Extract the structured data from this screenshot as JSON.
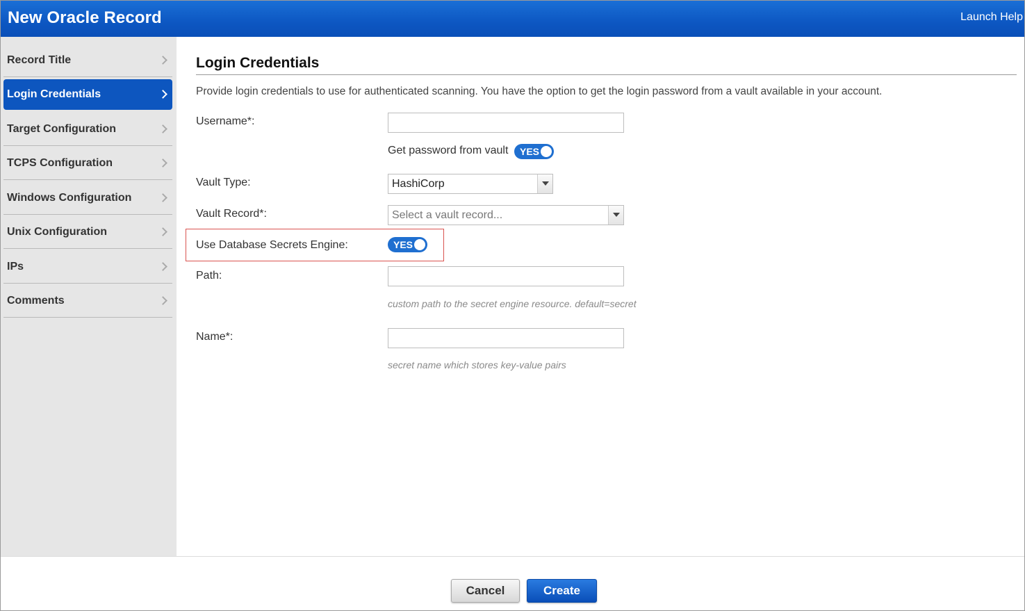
{
  "window": {
    "title": "New Oracle Record",
    "help_link": "Launch Help"
  },
  "sidebar": {
    "items": [
      {
        "label": "Record Title",
        "active": false
      },
      {
        "label": "Login Credentials",
        "active": true
      },
      {
        "label": "Target Configuration",
        "active": false
      },
      {
        "label": "TCPS Configuration",
        "active": false
      },
      {
        "label": "Windows Configuration",
        "active": false
      },
      {
        "label": "Unix Configuration",
        "active": false
      },
      {
        "label": "IPs",
        "active": false
      },
      {
        "label": "Comments",
        "active": false
      }
    ]
  },
  "form": {
    "section_title": "Login Credentials",
    "description": "Provide login credentials to use for authenticated scanning. You have the option to get the login password from a vault available in your account.",
    "username": {
      "label": "Username*:",
      "value": ""
    },
    "vault_toggle": {
      "label": "Get password from vault",
      "state": "YES"
    },
    "vault_type": {
      "label": "Vault Type:",
      "value": "HashiCorp"
    },
    "vault_record": {
      "label": "Vault Record*:",
      "placeholder": "Select a vault record..."
    },
    "secrets_engine": {
      "label": "Use Database Secrets Engine:",
      "state": "YES"
    },
    "path": {
      "label": "Path:",
      "value": "",
      "hint": "custom path to the secret engine resource. default=secret"
    },
    "name": {
      "label": "Name*:",
      "value": "",
      "hint": "secret name which stores key-value pairs"
    }
  },
  "footer": {
    "cancel_label": "Cancel",
    "create_label": "Create"
  },
  "colors": {
    "brand_blue": "#0d56bf",
    "toggle_blue": "#1f6fd0",
    "highlight_red": "#d9534f"
  }
}
